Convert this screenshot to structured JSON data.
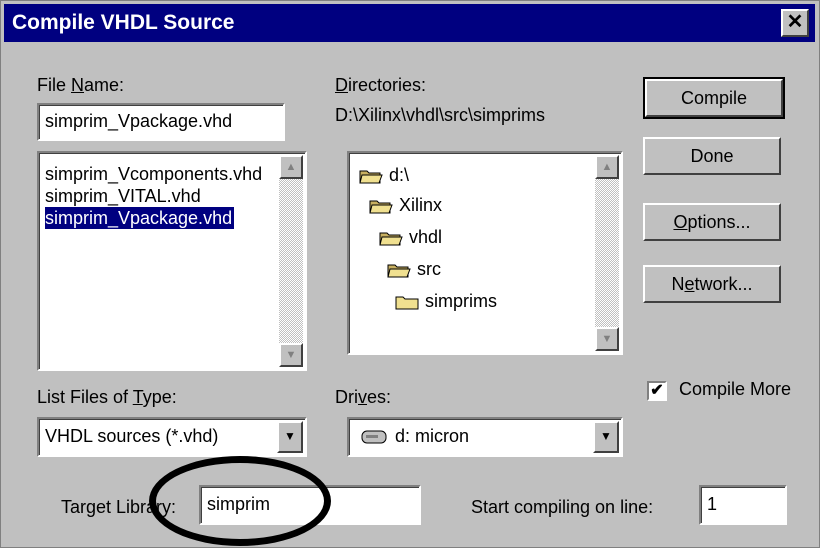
{
  "window": {
    "title": "Compile VHDL Source",
    "close_glyph": "✕"
  },
  "file_name": {
    "label_pre": "File ",
    "label_key": "N",
    "label_post": "ame:",
    "value": "simprim_Vpackage.vhd"
  },
  "file_list": {
    "items": [
      "simprim_Vcomponents.vhd",
      "simprim_VITAL.vhd",
      "simprim_Vpackage.vhd"
    ],
    "selected_index": 2
  },
  "directories": {
    "label_key": "D",
    "label_post": "irectories:",
    "path": "D:\\Xilinx\\vhdl\\src\\simprims",
    "folders": [
      "d:\\",
      "Xilinx",
      "vhdl",
      "src",
      "simprims"
    ]
  },
  "buttons": {
    "compile": "Compile",
    "done": "Done",
    "options_key": "O",
    "options_rest": "ptions...",
    "network_pre": "N",
    "network_key": "e",
    "network_rest": "twork..."
  },
  "file_type": {
    "label_pre": "List Files of ",
    "label_key": "T",
    "label_post": "ype:",
    "value": "VHDL sources (*.vhd)"
  },
  "drives": {
    "label_pre": "Dri",
    "label_key": "v",
    "label_post": "es:",
    "value": "d: micron"
  },
  "compile_more": {
    "label": "Compile More",
    "checked": true,
    "check_glyph": "✔"
  },
  "target_library": {
    "label": "Target Library:",
    "value": "simprim"
  },
  "start_line": {
    "label": "Start compiling on line:",
    "value": "1"
  },
  "icons": {
    "scroll_up": "▲",
    "scroll_down": "▼",
    "combo": "▼"
  },
  "colors": {
    "title_bar": "#000080",
    "face": "#c0c0c0",
    "selection": "#000080"
  }
}
